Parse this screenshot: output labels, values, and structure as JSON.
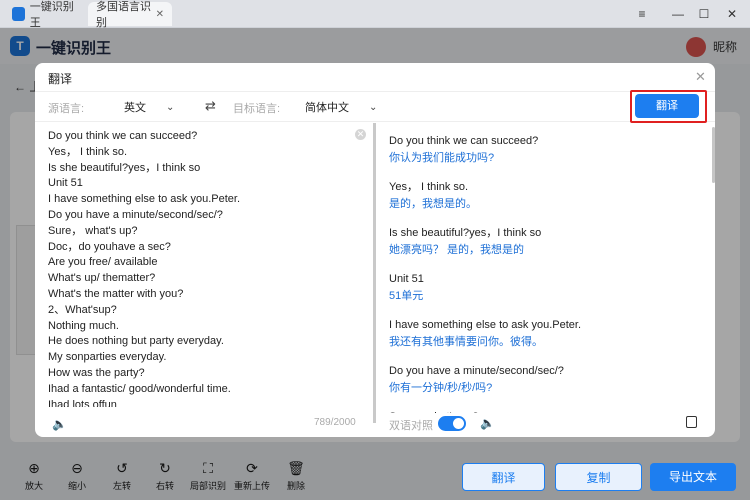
{
  "window": {
    "tab1": "一键识别王",
    "tab2": "多国语言识别",
    "app_name": "一键识别王",
    "user_nick": "昵称",
    "back_label": "上"
  },
  "dialog": {
    "title": "翻译",
    "source_label": "源语言:",
    "source_value": "英文",
    "target_label": "目标语言:",
    "target_value": "简体中文",
    "translate_button": "翻译",
    "char_count": "789/2000",
    "bilingual_label": "双语对照",
    "bilingual_on": true,
    "source_lines": [
      "Do you think we can succeed?",
      "Yes， I think so.",
      "Is she beautiful?yes，I think so",
      "Unit 51",
      "I have something else to ask you.Peter.",
      "Do you have a minute/second/sec/?",
      "Sure， what's up?",
      "Doc，do youhave a sec?",
      "Are you free/ available",
      "What's up/ thematter?",
      "What's the matter with you?",
      "2、What'sup?",
      "Nothing much.",
      "He does nothing but party everyday.",
      "My sonparties everyday.",
      "How was the party?",
      "Ihad a fantastic/ good/wonderful time.",
      "Ihad lots offun"
    ],
    "pairs": [
      {
        "en": "Do you think we can succeed?",
        "zh": "你认为我们能成功吗?"
      },
      {
        "en": "Yes， I think so.",
        "zh": "是的，我想是的。"
      },
      {
        "en": "Is she beautiful?yes，I think so",
        "zh": "她漂亮吗？ 是的，我想是的"
      },
      {
        "en": "Unit 51",
        "zh": "51单元"
      },
      {
        "en": "I have something else to ask you.Peter.",
        "zh": "我还有其他事情要问你。彼得。"
      },
      {
        "en": "Do you have a minute/second/sec/?",
        "zh": "你有一分钟/秒/秒/吗?"
      },
      {
        "en": "Sure， what's up?",
        "zh": ""
      }
    ]
  },
  "toolbar": {
    "tools": [
      {
        "label": "放大",
        "icon": "zoom-in-icon"
      },
      {
        "label": "缩小",
        "icon": "zoom-out-icon"
      },
      {
        "label": "左转",
        "icon": "rotate-left-icon"
      },
      {
        "label": "右转",
        "icon": "rotate-right-icon"
      },
      {
        "label": "局部识别",
        "icon": "scan-icon"
      },
      {
        "label": "重新上传",
        "icon": "refresh-icon"
      },
      {
        "label": "删除",
        "icon": "trash-icon"
      }
    ],
    "translate": "翻译",
    "copy": "复制",
    "export": "导出文本"
  },
  "colors": {
    "accent": "#1d7ef0",
    "highlight": "#e02020",
    "translation": "#1d6fd6"
  }
}
